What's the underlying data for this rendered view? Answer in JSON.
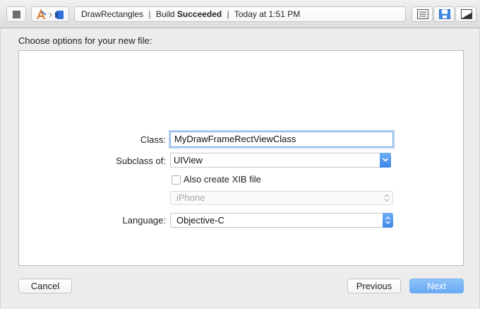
{
  "toolbar": {
    "activity": {
      "project": "DrawRectangles",
      "separator": "|",
      "build_prefix": "Build",
      "build_status": "Succeeded",
      "timestamp": "Today at 1:51 PM"
    },
    "icons": [
      "stop-icon",
      "xcode-app-icon",
      "chevron-right-icon",
      "ios-device-icon",
      "standard-editor-icon",
      "assistant-editor-icon",
      "version-editor-icon"
    ]
  },
  "sheet": {
    "title": "Choose options for your new file:",
    "class_label": "Class:",
    "class_value": "MyDrawFrameRectViewClass",
    "subclass_label": "Subclass of:",
    "subclass_value": "UIView",
    "xib_label": "Also create XIB file",
    "xib_checked": false,
    "device_value": "iPhone",
    "language_label": "Language:",
    "language_value": "Objective-C"
  },
  "buttons": {
    "cancel": "Cancel",
    "previous": "Previous",
    "next": "Next"
  },
  "colors": {
    "accent": "#4a92ee",
    "next_button": "#74b0f5"
  }
}
